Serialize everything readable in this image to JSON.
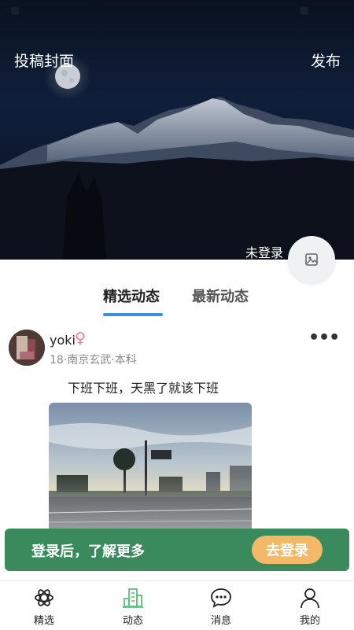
{
  "hero": {
    "left_action": "投稿封面",
    "right_action": "发布",
    "login_status": "未登录"
  },
  "tabs": [
    {
      "label": "精选动态",
      "active": true
    },
    {
      "label": "最新动态",
      "active": false
    }
  ],
  "post": {
    "username": "yoki",
    "gender_symbol": "♀",
    "meta": "18·南京玄武·本科",
    "more": "•••",
    "content": "下班下班，天黑了就该下班"
  },
  "login_banner": {
    "text": "登录后，了解更多",
    "button": "去登录"
  },
  "bottom_nav": [
    {
      "label": "精选",
      "icon": "featured-icon"
    },
    {
      "label": "动态",
      "icon": "building-icon",
      "active": true
    },
    {
      "label": "消息",
      "icon": "message-icon"
    },
    {
      "label": "我的",
      "icon": "profile-icon"
    }
  ],
  "colors": {
    "tab_underline": "#3b8fdc",
    "banner_bg": "#3a8a5e",
    "banner_button": "#f3b968",
    "active_nav": "#5cc07a",
    "female_icon": "#ff6fa0"
  }
}
